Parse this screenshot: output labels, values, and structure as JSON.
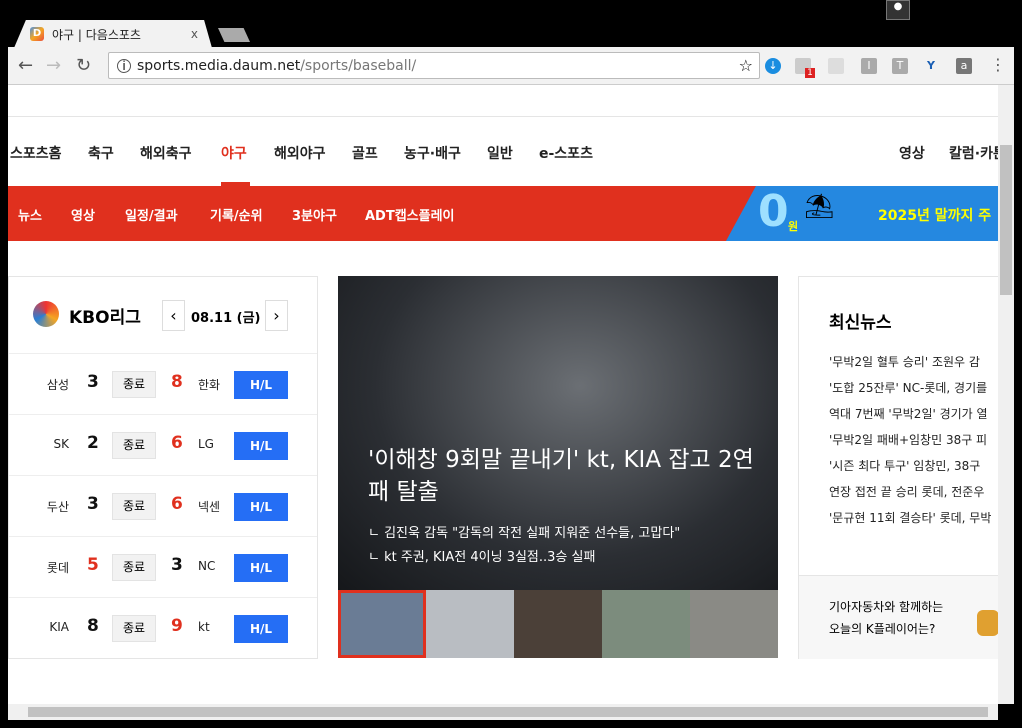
{
  "browser": {
    "tab_title": "야구 | 다음스포츠",
    "favicon": "D",
    "close": "x",
    "url_host": "sports.media.daum.net",
    "url_path": "/sports/baseball/",
    "ext_badge": "1"
  },
  "nav": {
    "items": [
      "스포츠홈",
      "축구",
      "해외축구",
      "야구",
      "해외야구",
      "골프",
      "농구·배구",
      "일반",
      "e-스포츠"
    ],
    "right": [
      "영상",
      "칼럼·카툰"
    ]
  },
  "subnav": {
    "items": [
      "뉴스",
      "영상",
      "일정/결과",
      "기록/순위",
      "3분야구",
      "ADT캡스플레이"
    ]
  },
  "ad": {
    "big": "0",
    "won": "원",
    "text": "2025년 말까지 주"
  },
  "score": {
    "title": "KBO리그",
    "date": "08.11 (금)",
    "prev": "‹",
    "next": "›",
    "games": [
      {
        "home": "삼성",
        "hs": "3",
        "status": "종료",
        "as": "8",
        "away": "한화",
        "win": "away",
        "hl": "H/L"
      },
      {
        "home": "SK",
        "hs": "2",
        "status": "종료",
        "as": "6",
        "away": "LG",
        "win": "away",
        "hl": "H/L"
      },
      {
        "home": "두산",
        "hs": "3",
        "status": "종료",
        "as": "6",
        "away": "넥센",
        "win": "away",
        "hl": "H/L"
      },
      {
        "home": "롯데",
        "hs": "5",
        "status": "종료",
        "as": "3",
        "away": "NC",
        "win": "home",
        "hl": "H/L"
      },
      {
        "home": "KIA",
        "hs": "8",
        "status": "종료",
        "as": "9",
        "away": "kt",
        "win": "away",
        "hl": "H/L"
      }
    ]
  },
  "hero": {
    "headline": "'이해창 9회말 끝내기' kt, KIA 잡고 2연패 탈출",
    "sub": [
      "ㄴ 김진욱 감독 \"감독의 작전 실패 지워준 선수들, 고맙다\"",
      "ㄴ kt 주권, KIA전 4이닝 3실점..3승 실패"
    ]
  },
  "news": {
    "title": "최신뉴스",
    "items": [
      "'무박2일 혈투 승리' 조원우 감",
      "'도합 25잔루' NC-롯데, 경기를",
      "역대 7번째 '무박2일' 경기가 열",
      "'무박2일 패배+임창민 38구 피",
      "'시즌 최다 투구' 임창민, 38구",
      "연장 접전 끝 승리 롯데, 전준우",
      "'문규현 11회 결승타' 롯데, 무박"
    ],
    "promo": [
      "기아자동차와 함께하는",
      "오늘의 K플레이어는?"
    ]
  },
  "colors": {
    "accent": "#e0301e",
    "hl": "#256ef5"
  }
}
